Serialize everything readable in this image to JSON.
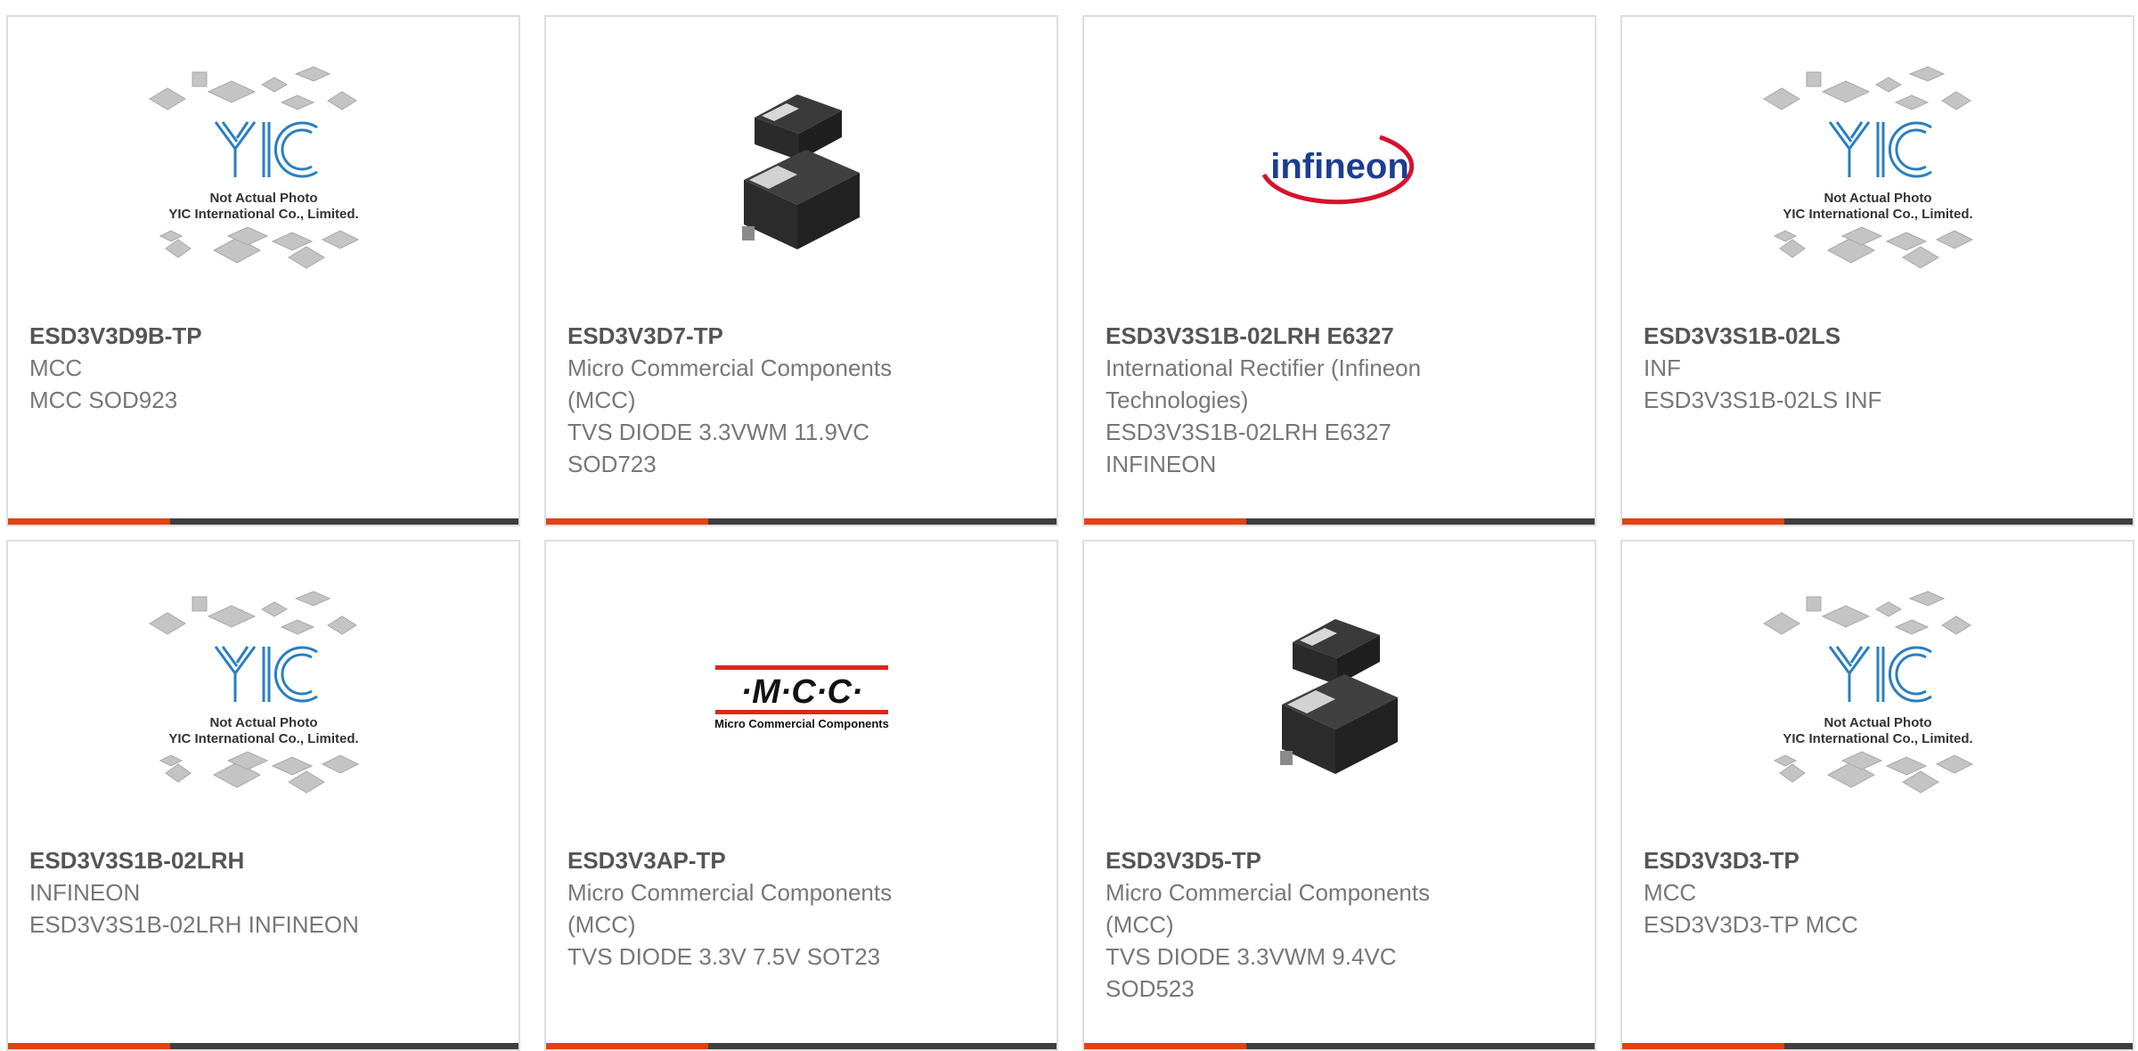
{
  "colors": {
    "accent": "#e3410f",
    "bar_dark": "#3f3f3f",
    "part_number": "#555555",
    "text_gray": "#777777",
    "yic_blue": "#2a7fc0",
    "infineon_blue": "#1c3e8f",
    "infineon_red": "#d6122e",
    "mcc_red": "#d9281c"
  },
  "products": [
    {
      "image": "yic-placeholder",
      "placeholder_line1": "Not Actual Photo",
      "placeholder_line2": "YIC International Co., Limited.",
      "part_number": "ESD3V3D9B-TP",
      "manufacturer": "MCC",
      "description": "MCC SOD923"
    },
    {
      "image": "sod-package-photo",
      "part_number": "ESD3V3D7-TP",
      "manufacturer": "Micro Commercial Components (MCC)",
      "description": "TVS DIODE 3.3VWM 11.9VC SOD723"
    },
    {
      "image": "infineon-logo",
      "logo_text": "infineon",
      "part_number": "ESD3V3S1B-02LRH E6327",
      "manufacturer": "International Rectifier (Infineon Technologies)",
      "description": "ESD3V3S1B-02LRH E6327 INFINEON"
    },
    {
      "image": "yic-placeholder",
      "placeholder_line1": "Not Actual Photo",
      "placeholder_line2": "YIC International Co., Limited.",
      "part_number": "ESD3V3S1B-02LS",
      "manufacturer": "INF",
      "description": "ESD3V3S1B-02LS INF"
    },
    {
      "image": "yic-placeholder",
      "placeholder_line1": "Not Actual Photo",
      "placeholder_line2": "YIC International Co., Limited.",
      "part_number": "ESD3V3S1B-02LRH",
      "manufacturer": "INFINEON",
      "description": "ESD3V3S1B-02LRH INFINEON"
    },
    {
      "image": "mcc-logo",
      "logo_text": "·M·C·C·",
      "logo_subtext": "Micro Commercial Components",
      "part_number": "ESD3V3AP-TP",
      "manufacturer": "Micro Commercial Components (MCC)",
      "description": "TVS DIODE 3.3V 7.5V SOT23"
    },
    {
      "image": "sod-package-photo",
      "part_number": "ESD3V3D5-TP",
      "manufacturer": "Micro Commercial Components (MCC)",
      "description": "TVS DIODE 3.3VWM 9.4VC SOD523"
    },
    {
      "image": "yic-placeholder",
      "placeholder_line1": "Not Actual Photo",
      "placeholder_line2": "YIC International Co., Limited.",
      "part_number": "ESD3V3D3-TP",
      "manufacturer": "MCC",
      "description": "ESD3V3D3-TP MCC"
    }
  ]
}
